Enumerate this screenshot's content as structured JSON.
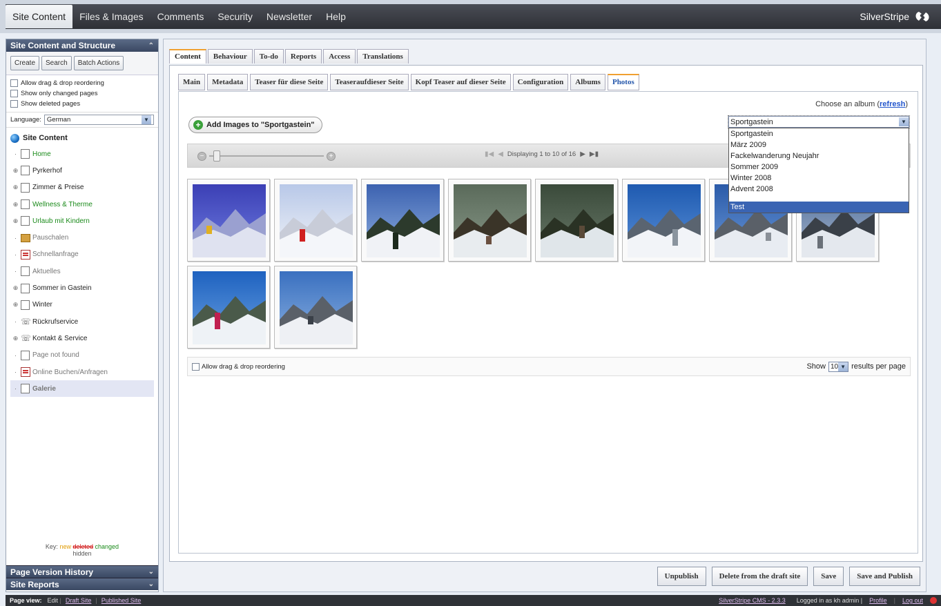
{
  "topnav": {
    "items": [
      "Site Content",
      "Files & Images",
      "Comments",
      "Security",
      "Newsletter",
      "Help"
    ],
    "active": 0,
    "brand": "SilverStripe"
  },
  "left": {
    "panel_title": "Site Content and Structure",
    "buttons": [
      "Create",
      "Search",
      "Batch Actions"
    ],
    "options": [
      "Allow drag & drop reordering",
      "Show only changed pages",
      "Show deleted pages"
    ],
    "language_label": "Language:",
    "language_value": "German",
    "tree_root": "Site Content",
    "tree": [
      {
        "label": "Home",
        "style": "green",
        "icon": "page",
        "expandable": false
      },
      {
        "label": "Pyrkerhof",
        "style": "",
        "icon": "page",
        "expandable": true
      },
      {
        "label": "Zimmer & Preise",
        "style": "",
        "icon": "page",
        "expandable": true
      },
      {
        "label": "Wellness & Therme",
        "style": "green",
        "icon": "page",
        "expandable": true
      },
      {
        "label": "Urlaub mit Kindern",
        "style": "green",
        "icon": "page",
        "expandable": true
      },
      {
        "label": "Pauschalen",
        "style": "grey",
        "icon": "package",
        "expandable": false
      },
      {
        "label": "Schnellanfrage",
        "style": "grey",
        "icon": "form",
        "expandable": false
      },
      {
        "label": "Aktuelles",
        "style": "grey",
        "icon": "page",
        "expandable": false
      },
      {
        "label": "Sommer in Gastein",
        "style": "",
        "icon": "page",
        "expandable": true
      },
      {
        "label": "Winter",
        "style": "",
        "icon": "page",
        "expandable": true
      },
      {
        "label": "Rückrufservice",
        "style": "",
        "icon": "phone",
        "expandable": false
      },
      {
        "label": "Kontakt & Service",
        "style": "",
        "icon": "phone",
        "expandable": true
      },
      {
        "label": "Page not found",
        "style": "grey",
        "icon": "page",
        "expandable": false
      },
      {
        "label": "Online Buchen/Anfragen",
        "style": "grey",
        "icon": "form",
        "expandable": false
      },
      {
        "label": "Galerie",
        "style": "grey",
        "icon": "page",
        "expandable": false,
        "selected": true
      }
    ],
    "key": {
      "label": "Key:",
      "new": "new",
      "deleted": "deleted",
      "changed": "changed",
      "hidden": "hidden"
    },
    "bottom_panels": [
      "Page Version History",
      "Site Reports"
    ]
  },
  "main": {
    "outer_tabs": [
      "Content",
      "Behaviour",
      "To-do",
      "Reports",
      "Access",
      "Translations"
    ],
    "inner_tabs": [
      "Main",
      "Metadata",
      "Teaser für diese Seite",
      "Teaseraufdieser Seite",
      "Kopf Teaser auf dieser Seite",
      "Configuration",
      "Albums",
      "Photos"
    ],
    "album_label": "Choose an album",
    "album_refresh": "refresh",
    "album_selected": "Sportgastein",
    "album_options": [
      "Sportgastein",
      "März 2009",
      "Fackelwanderung Neujahr",
      "Sommer 2009",
      "Winter 2008",
      "Advent 2008",
      "",
      "Test"
    ],
    "add_button": "Add Images to \"Sportgastein\"",
    "pager_text": "Displaying 1 to 10 of 16",
    "photos": [
      "photo-1",
      "photo-2",
      "photo-3",
      "photo-4",
      "photo-5",
      "photo-6",
      "photo-7",
      "photo-8",
      "photo-9",
      "photo-10"
    ],
    "footer_drag": "Allow drag & drop reordering",
    "show_label": "Show",
    "per_page": "10",
    "per_page_suffix": "results per page",
    "actions": [
      "Unpublish",
      "Delete from the draft site",
      "Save",
      "Save and Publish"
    ]
  },
  "status": {
    "page_view": "Page view:",
    "edit": "Edit",
    "draft": "Draft Site",
    "published": "Published Site",
    "cms_version": "SilverStripe CMS - 2.3.3",
    "logged_in": "Logged in as kh admin |",
    "profile": "Profile",
    "logout": "Log out"
  },
  "colors": {
    "accent": "#f0a030",
    "selection": "#3a64b3",
    "nav_dark": "#2e3036",
    "changed_green": "#1a8a1a"
  }
}
